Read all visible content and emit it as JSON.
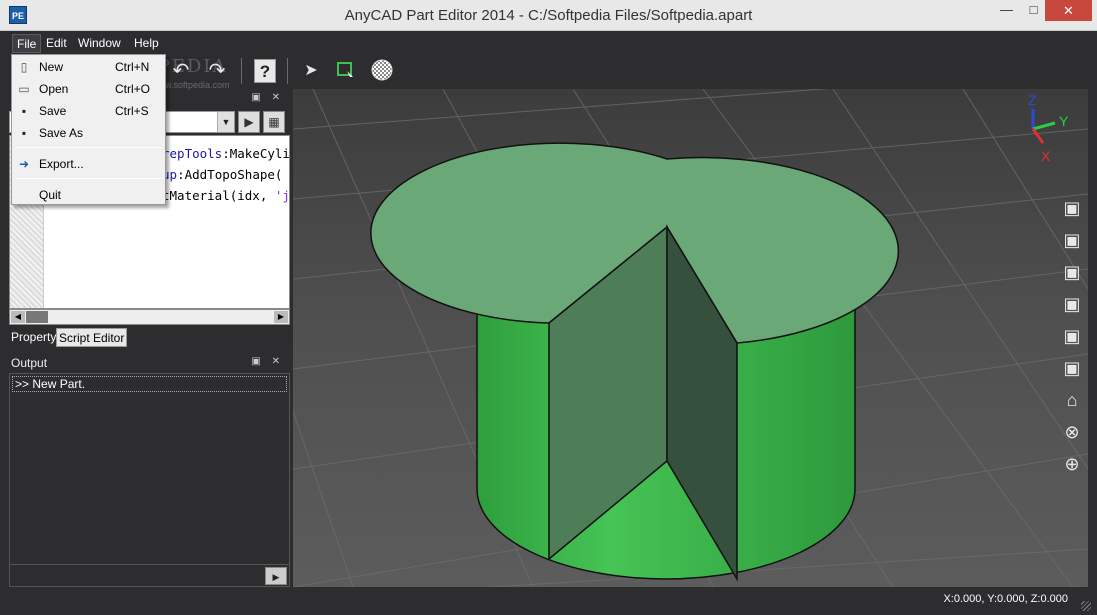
{
  "window": {
    "app_icon_label": "PE",
    "title": "AnyCAD Part Editor 2014 - C:/Softpedia Files/Softpedia.apart",
    "minimize": "—",
    "maximize": "□",
    "close": "✕"
  },
  "menubar": {
    "items": [
      {
        "label": "File"
      },
      {
        "label": "Edit"
      },
      {
        "label": "Window"
      },
      {
        "label": "Help"
      }
    ]
  },
  "toolbar": {
    "help_label": "?"
  },
  "file_menu": {
    "items": [
      {
        "label": "New",
        "shortcut": "Ctrl+N",
        "icon": "new-document-icon"
      },
      {
        "label": "Open",
        "shortcut": "Ctrl+O",
        "icon": "open-folder-icon"
      },
      {
        "label": "Save",
        "shortcut": "Ctrl+S",
        "icon": "save-icon"
      },
      {
        "label": "Save As",
        "shortcut": "",
        "icon": "save-as-icon"
      },
      {
        "label": "Export...",
        "shortcut": "",
        "icon": "export-icon"
      },
      {
        "label": "Quit",
        "shortcut": "",
        "icon": ""
      }
    ]
  },
  "script_editor": {
    "panel_controls": "▣ ✕",
    "code_lines": [
      {
        "pre": "",
        "name": "repTools",
        "post": ":MakeCylir"
      },
      {
        "pre": "",
        "name": "up",
        "post": ":AddTopoShape("
      },
      {
        "pre": "tMaterial(idx, ",
        "name": "",
        "post": "",
        "str": "'jade"
      }
    ]
  },
  "tabs": [
    {
      "label": "Property",
      "active": false
    },
    {
      "label": "Script Editor",
      "active": true
    }
  ],
  "output": {
    "title": "Output",
    "panel_controls": "▣ ✕",
    "lines": [
      ">> New Part."
    ]
  },
  "axes": {
    "x": "X",
    "y": "Y",
    "z": "Z"
  },
  "watermark": {
    "text": "SOFTPEDIA",
    "url": "www.softpedia.com"
  },
  "statusbar": {
    "coordinates": "X:0.000, Y:0.000, Z:0.000"
  },
  "colors": {
    "cylinder_side": "#3fbf4f",
    "cylinder_top": "#6aa877",
    "cut_face_light": "#4f7f58",
    "cut_face_dark": "#35503c",
    "background": "#2d2d30"
  }
}
